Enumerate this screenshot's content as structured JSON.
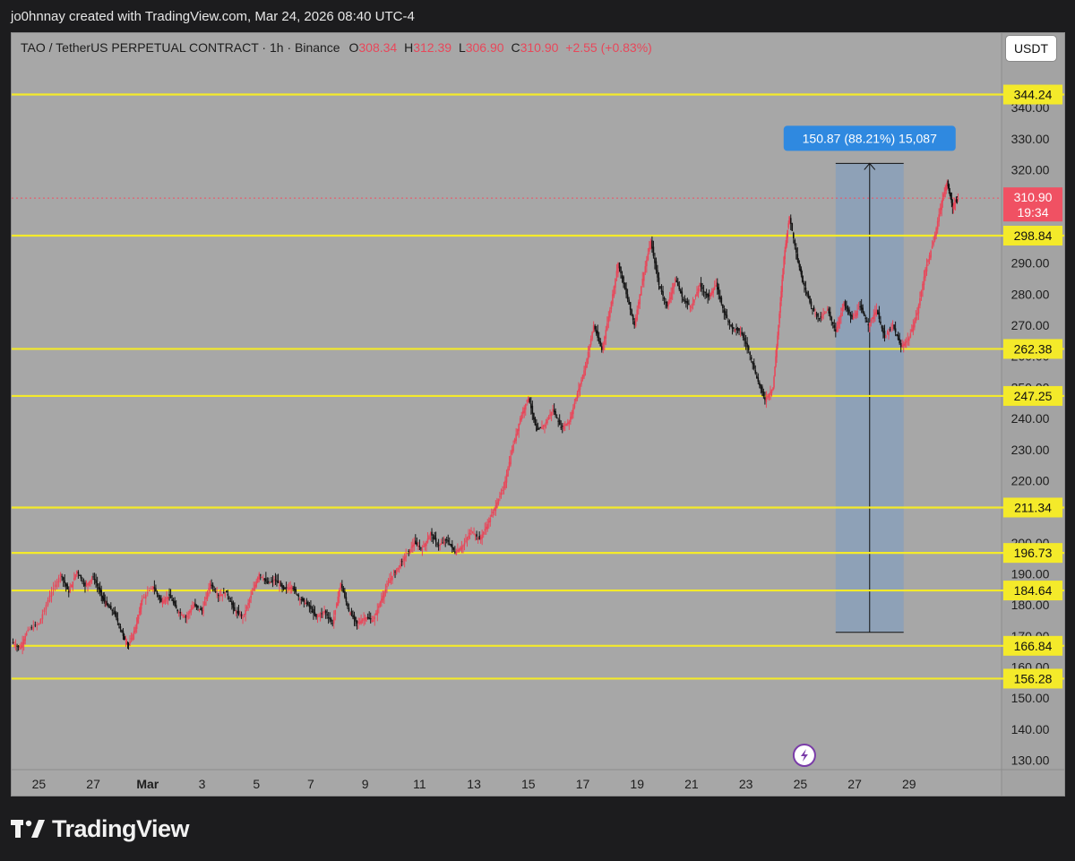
{
  "header": {
    "credit": "jo0hnnay created with TradingView.com, Mar 24, 2026 08:40 UTC-4"
  },
  "legend": {
    "symbol": "TAO / TetherUS PERPETUAL CONTRACT · 1h · Binance",
    "o_label": "O",
    "o_value": "308.34",
    "h_label": "H",
    "h_value": "312.39",
    "l_label": "L",
    "l_value": "306.90",
    "c_label": "C",
    "c_value": "310.90",
    "change": "+2.55 (+0.83%)"
  },
  "unit_button": "USDT",
  "footer": {
    "brand": "TradingView"
  },
  "colors": {
    "background": "#a7a7a7",
    "level_line": "#f4ea2a",
    "bull": "#e8475a",
    "bear": "#141414",
    "measure_fill": "#7a9cc4",
    "measure_label": "#2f89e0",
    "price_tag": "#f05163"
  },
  "chart_data": {
    "type": "candlestick",
    "symbol": "TAO / TetherUS PERPETUAL CONTRACT",
    "timeframe": "1h",
    "exchange": "Binance",
    "y_ticks": [
      "340.00",
      "330.00",
      "320.00",
      "310.00",
      "300.00",
      "290.00",
      "280.00",
      "270.00",
      "260.00",
      "250.00",
      "240.00",
      "230.00",
      "220.00",
      "210.00",
      "200.00",
      "190.00",
      "180.00",
      "170.00",
      "160.00",
      "150.00",
      "140.00",
      "130.00"
    ],
    "y_tick_values": [
      340,
      330,
      320,
      310,
      300,
      290,
      280,
      270,
      260,
      250,
      240,
      230,
      220,
      210,
      200,
      190,
      180,
      170,
      160,
      150,
      140,
      130
    ],
    "ylim": [
      127,
      364
    ],
    "x_ticks": [
      "25",
      "27",
      "Mar",
      "3",
      "5",
      "7",
      "9",
      "11",
      "13",
      "15",
      "17",
      "19",
      "21",
      "23",
      "25",
      "27",
      "29"
    ],
    "x_tick_days": [
      -4,
      -2,
      0,
      2,
      4,
      6,
      8,
      10,
      12,
      14,
      16,
      18,
      20,
      22,
      24,
      26,
      28
    ],
    "xlim": [
      -5,
      31.4
    ],
    "horizontal_levels": [
      {
        "value": 344.24,
        "label": "344.24"
      },
      {
        "value": 298.84,
        "label": "298.84"
      },
      {
        "value": 262.38,
        "label": "262.38"
      },
      {
        "value": 247.25,
        "label": "247.25"
      },
      {
        "value": 211.34,
        "label": "211.34"
      },
      {
        "value": 196.73,
        "label": "196.73"
      },
      {
        "value": 184.64,
        "label": "184.64"
      },
      {
        "value": 166.84,
        "label": "166.84"
      },
      {
        "value": 156.28,
        "label": "156.28"
      }
    ],
    "last_price": {
      "value": 310.9,
      "label": "310.90",
      "countdown": "19:34"
    },
    "measure": {
      "from": 171.2,
      "to": 322.07,
      "x_start": 25.3,
      "x_end": 27.8,
      "label": "150.87 (88.21%) 15,087"
    },
    "path": [
      [
        -5.0,
        168
      ],
      [
        -4.7,
        166
      ],
      [
        -4.4,
        172
      ],
      [
        -4.0,
        174
      ],
      [
        -3.6,
        183
      ],
      [
        -3.2,
        190
      ],
      [
        -2.9,
        184
      ],
      [
        -2.6,
        191
      ],
      [
        -2.3,
        186
      ],
      [
        -2.0,
        189
      ],
      [
        -1.7,
        183
      ],
      [
        -1.5,
        180
      ],
      [
        -1.2,
        177
      ],
      [
        -0.9,
        170
      ],
      [
        -0.7,
        167
      ],
      [
        -0.4,
        174
      ],
      [
        -0.2,
        182
      ],
      [
        0.2,
        186
      ],
      [
        0.5,
        181
      ],
      [
        0.8,
        183
      ],
      [
        1.1,
        178
      ],
      [
        1.4,
        176
      ],
      [
        1.7,
        180
      ],
      [
        2.0,
        178
      ],
      [
        2.3,
        187
      ],
      [
        2.6,
        183
      ],
      [
        2.9,
        184
      ],
      [
        3.2,
        178
      ],
      [
        3.5,
        176
      ],
      [
        3.8,
        183
      ],
      [
        4.1,
        190
      ],
      [
        4.4,
        187
      ],
      [
        4.7,
        188
      ],
      [
        5.0,
        185
      ],
      [
        5.3,
        186
      ],
      [
        5.6,
        182
      ],
      [
        5.9,
        180
      ],
      [
        6.2,
        176
      ],
      [
        6.5,
        178
      ],
      [
        6.8,
        174
      ],
      [
        7.1,
        187
      ],
      [
        7.4,
        178
      ],
      [
        7.7,
        174
      ],
      [
        8.0,
        176
      ],
      [
        8.3,
        175
      ],
      [
        8.6,
        182
      ],
      [
        8.9,
        188
      ],
      [
        9.2,
        192
      ],
      [
        9.5,
        196
      ],
      [
        9.8,
        200
      ],
      [
        10.1,
        198
      ],
      [
        10.4,
        203
      ],
      [
        10.7,
        199
      ],
      [
        11.0,
        201
      ],
      [
        11.3,
        197
      ],
      [
        11.6,
        199
      ],
      [
        11.9,
        204
      ],
      [
        12.2,
        201
      ],
      [
        12.5,
        206
      ],
      [
        12.8,
        212
      ],
      [
        13.1,
        218
      ],
      [
        13.4,
        230
      ],
      [
        13.7,
        240
      ],
      [
        14.0,
        247
      ],
      [
        14.3,
        236
      ],
      [
        14.6,
        238
      ],
      [
        14.9,
        243
      ],
      [
        15.2,
        237
      ],
      [
        15.5,
        239
      ],
      [
        15.8,
        248
      ],
      [
        16.1,
        257
      ],
      [
        16.4,
        270
      ],
      [
        16.7,
        262
      ],
      [
        17.0,
        275
      ],
      [
        17.3,
        290
      ],
      [
        17.6,
        280
      ],
      [
        17.9,
        270
      ],
      [
        18.2,
        285
      ],
      [
        18.5,
        297
      ],
      [
        18.8,
        283
      ],
      [
        19.1,
        276
      ],
      [
        19.4,
        285
      ],
      [
        19.7,
        278
      ],
      [
        20.0,
        276
      ],
      [
        20.3,
        283
      ],
      [
        20.6,
        279
      ],
      [
        20.9,
        283
      ],
      [
        21.2,
        274
      ],
      [
        21.5,
        269
      ],
      [
        21.8,
        268
      ],
      [
        22.1,
        262
      ],
      [
        22.4,
        253
      ],
      [
        22.7,
        246
      ],
      [
        23.0,
        250
      ],
      [
        23.2,
        270
      ],
      [
        23.4,
        292
      ],
      [
        23.6,
        305
      ],
      [
        23.9,
        291
      ],
      [
        24.1,
        284
      ],
      [
        24.4,
        276
      ],
      [
        24.7,
        272
      ],
      [
        25.0,
        275
      ],
      [
        25.3,
        268
      ],
      [
        25.6,
        277
      ],
      [
        25.9,
        272
      ],
      [
        26.2,
        276
      ],
      [
        26.5,
        270
      ],
      [
        26.8,
        275
      ],
      [
        27.1,
        266
      ],
      [
        27.4,
        270
      ],
      [
        27.7,
        263
      ],
      [
        28.0,
        266
      ],
      [
        28.3,
        274
      ],
      [
        28.6,
        288
      ],
      [
        28.9,
        297
      ],
      [
        29.2,
        310
      ],
      [
        29.4,
        316
      ],
      [
        29.6,
        308
      ],
      [
        29.8,
        310.9
      ]
    ]
  }
}
